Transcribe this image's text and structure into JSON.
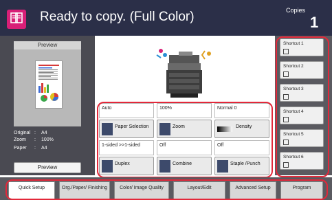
{
  "header": {
    "status": "Ready to copy. (Full Color)",
    "copies_label": "Copies",
    "copies_value": "1"
  },
  "preview": {
    "title": "Preview",
    "button_label": "Preview",
    "info": [
      {
        "label": "Original",
        "value": "A4"
      },
      {
        "label": "Zoom",
        "value": "100%"
      },
      {
        "label": "Paper",
        "value": "A4"
      }
    ]
  },
  "functions": [
    {
      "value": "Auto",
      "label": "Paper Selection",
      "icon": "paper-tray-icon"
    },
    {
      "value": "100%",
      "label": "Zoom",
      "icon": "zoom-icon"
    },
    {
      "value": "Normal 0",
      "label": "Density",
      "icon": "density-icon"
    },
    {
      "value": "1-sided >>1-sided",
      "label": "Duplex",
      "icon": "duplex-icon"
    },
    {
      "value": "Off",
      "label": "Combine",
      "icon": "combine-icon"
    },
    {
      "value": "Off",
      "label": "Staple /Punch",
      "icon": "staple-icon"
    }
  ],
  "shortcuts": [
    {
      "label": "Shortcut 1"
    },
    {
      "label": "Shortcut 2"
    },
    {
      "label": "Shortcut 3"
    },
    {
      "label": "Shortcut 4"
    },
    {
      "label": "Shortcut 5"
    },
    {
      "label": "Shortcut 6"
    }
  ],
  "tabs": [
    {
      "label": "Quick Setup",
      "active": true
    },
    {
      "label": "Org./Paper/ Finishing"
    },
    {
      "label": "Color/ Image Quality"
    },
    {
      "label": "Layout/Edit"
    },
    {
      "label": "Advanced Setup"
    },
    {
      "label": "Program"
    }
  ],
  "colors": {
    "header_bg": "#2b2f48",
    "home_button": "#d81f77",
    "highlight": "#e3283a"
  }
}
